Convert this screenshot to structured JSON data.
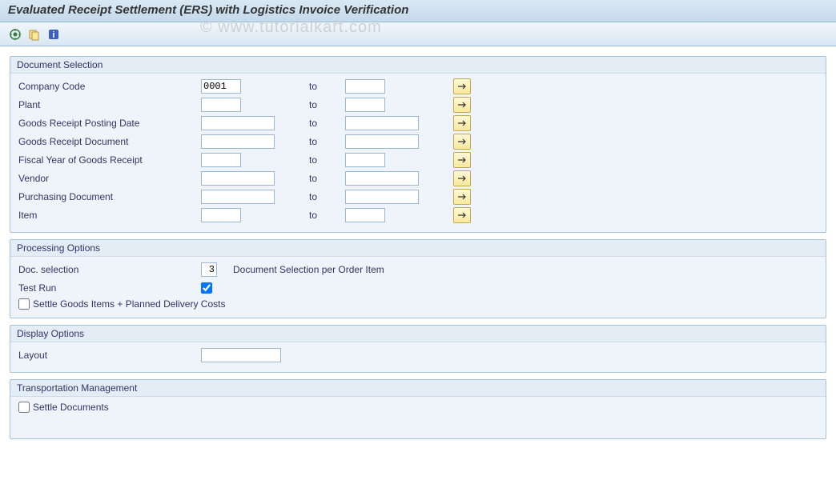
{
  "title": "Evaluated Receipt Settlement (ERS) with Logistics Invoice Verification",
  "watermark": "© www.tutorialkart.com",
  "groups": {
    "doc_sel": {
      "title": "Document Selection",
      "rows": {
        "company_code": {
          "label": "Company Code",
          "from": "0001",
          "to_label": "to",
          "to": ""
        },
        "plant": {
          "label": "Plant",
          "from": "",
          "to_label": "to",
          "to": ""
        },
        "gr_post_date": {
          "label": "Goods Receipt Posting Date",
          "from": "",
          "to_label": "to",
          "to": ""
        },
        "gr_doc": {
          "label": "Goods Receipt Document",
          "from": "",
          "to_label": "to",
          "to": ""
        },
        "fy_gr": {
          "label": "Fiscal Year of Goods Receipt",
          "from": "",
          "to_label": "to",
          "to": ""
        },
        "vendor": {
          "label": "Vendor",
          "from": "",
          "to_label": "to",
          "to": ""
        },
        "purch_doc": {
          "label": "Purchasing Document",
          "from": "",
          "to_label": "to",
          "to": ""
        },
        "item": {
          "label": "Item",
          "from": "",
          "to_label": "to",
          "to": ""
        }
      }
    },
    "proc_opt": {
      "title": "Processing Options",
      "doc_sel_label": "Doc. selection",
      "doc_sel_value": "3",
      "doc_sel_desc": "Document Selection per Order Item",
      "test_run_label": "Test Run",
      "test_run_checked": true,
      "settle_goods_label": "Settle Goods Items + Planned Delivery Costs",
      "settle_goods_checked": false
    },
    "disp_opt": {
      "title": "Display Options",
      "layout_label": "Layout",
      "layout_value": ""
    },
    "trans_mgmt": {
      "title": "Transportation Management",
      "settle_docs_label": "Settle Documents",
      "settle_docs_checked": false
    }
  }
}
